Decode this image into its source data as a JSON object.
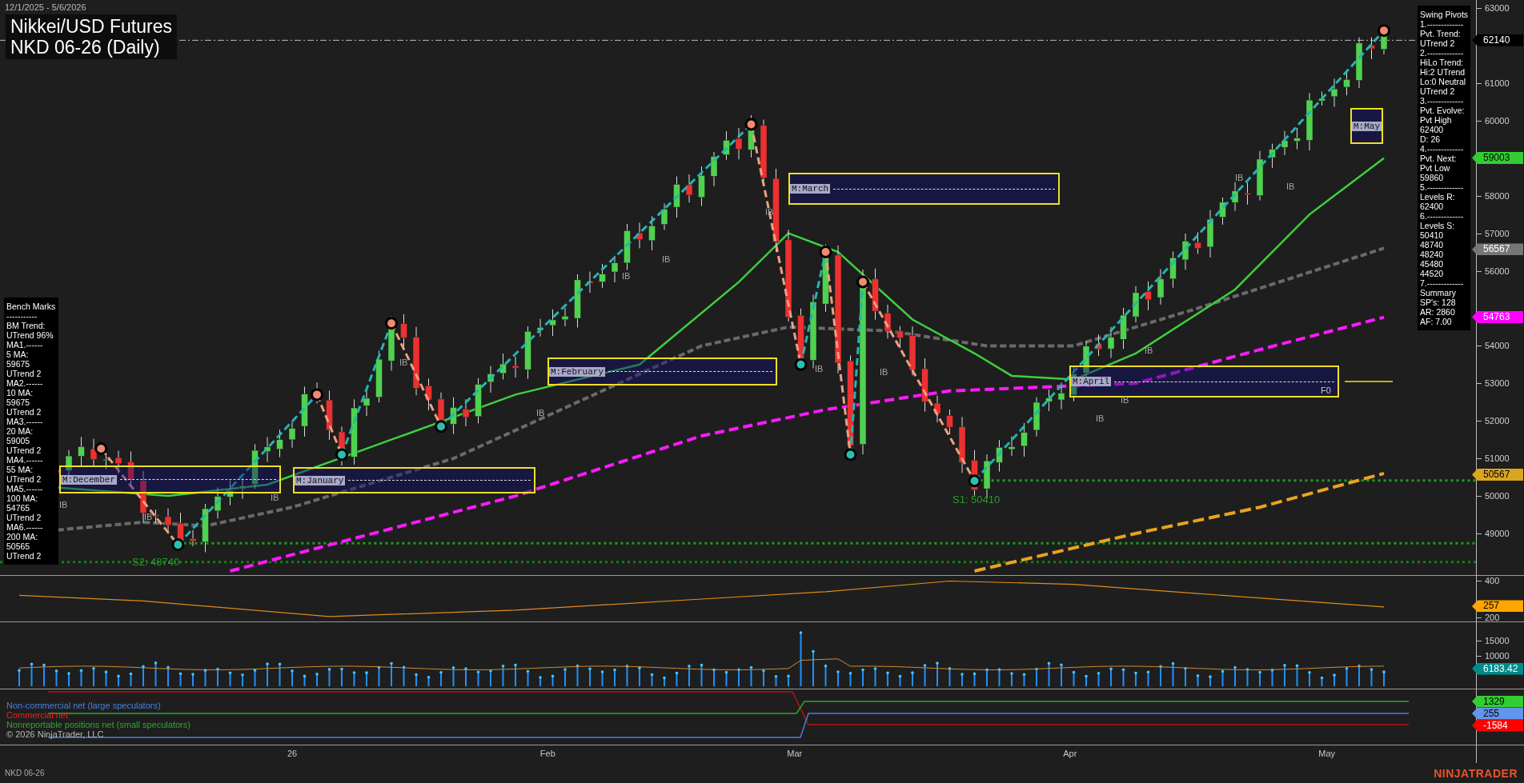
{
  "chart_header": {
    "date_range": "12/1/2025 - 5/6/2026",
    "title": "Nikkei/USD Futures",
    "subtitle": "NKD 06-26 (Daily)"
  },
  "swing_pivots_panel": {
    "lines": [
      "Swing Pivots",
      "1.-------------",
      "Pvt. Trend:",
      "UTrend 2",
      "2.-------------",
      "HiLo Trend:",
      "Hi:2 UTrend",
      "Lo:0 Neutral",
      "UTrend 2",
      "3.-------------",
      "Pvt. Evolve:",
      "Pvt High",
      "62400",
      "D: 26",
      "4.-------------",
      "Pvt. Next:",
      "Pvt Low",
      "59860",
      "5.-------------",
      "Levels R:",
      "62400",
      "6.-------------",
      "Levels S:",
      "50410",
      "48740",
      "48240",
      "45480",
      "44520",
      "7.-------------",
      "Summary",
      "SP's: 128",
      "AR: 2860",
      "AF: 7.00"
    ]
  },
  "bench_marks_panel": {
    "lines": [
      "Bench Marks",
      "-----------",
      "BM Trend:",
      "UTrend 96%",
      "MA1.------",
      "5 MA:",
      "59675",
      "UTrend 2",
      "MA2.------",
      "10 MA:",
      "59675",
      "UTrend 2",
      "MA3.------",
      "20 MA:",
      "59005",
      "UTrend 2",
      "MA4.------",
      "55 MA:",
      "UTrend 2",
      "MA5.------",
      "100 MA:",
      "54765",
      "UTrend 2",
      "MA6.------",
      "200 MA:",
      "50565",
      "UTrend 2"
    ]
  },
  "zones": [
    {
      "label": "M:December"
    },
    {
      "label": "M:January"
    },
    {
      "label": "M:February"
    },
    {
      "label": "M:March"
    },
    {
      "label": "M:April"
    },
    {
      "label": "M:May"
    }
  ],
  "chart_labels": {
    "ib": [
      "IB",
      "IB",
      "IB",
      "IB",
      "IB",
      "IB",
      "IB",
      "IB",
      "IB",
      "IB",
      "IB",
      "IB",
      "IB",
      "IB",
      "IB"
    ],
    "support": [
      "S1: 50410",
      "S2: 48740"
    ],
    "fib": "F0"
  },
  "price_axis": {
    "ticks": [
      "63000",
      "61000",
      "60000",
      "58000",
      "57000",
      "56000",
      "54000",
      "53000",
      "52000",
      "51000",
      "50000",
      "49000"
    ],
    "markers": [
      {
        "label": "62140",
        "color": "#000000"
      },
      {
        "label": "59003",
        "color": "#32cd32"
      },
      {
        "label": "56567",
        "color": "#777777"
      },
      {
        "label": "54763",
        "color": "#ff00ff"
      },
      {
        "label": "50567",
        "color": "#daa520"
      }
    ]
  },
  "oscillator_axis": {
    "ticks": [
      "400",
      "200"
    ],
    "markers": [
      {
        "label": "257",
        "color": "#ffa500"
      }
    ]
  },
  "volume_axis": {
    "ticks": [
      "15000",
      "10000"
    ],
    "markers": [
      {
        "label": "6183.42",
        "color": "#008b8b"
      }
    ]
  },
  "cot_panel": {
    "legend": [
      {
        "label": "Non-commercial net (large speculators)",
        "color": "#4a7fe0"
      },
      {
        "label": "Commercial net",
        "color": "#ff1a1a"
      },
      {
        "label": "Nonreportable positions net (small speculators)",
        "color": "#2ea82e"
      }
    ],
    "copyright": "© 2026 NinjaTrader, LLC"
  },
  "cot_axis": {
    "markers": [
      {
        "label": "1329",
        "color": "#32cd32"
      },
      {
        "label": "255",
        "color": "#6495ed"
      },
      {
        "label": "-1584",
        "color": "#ff0000"
      }
    ]
  },
  "time_axis": {
    "labels": [
      "26",
      "Feb",
      "Mar",
      "Apr",
      "May"
    ]
  },
  "footer": {
    "instrument": "NKD 06-26",
    "logo": "NINJATRADER"
  }
}
